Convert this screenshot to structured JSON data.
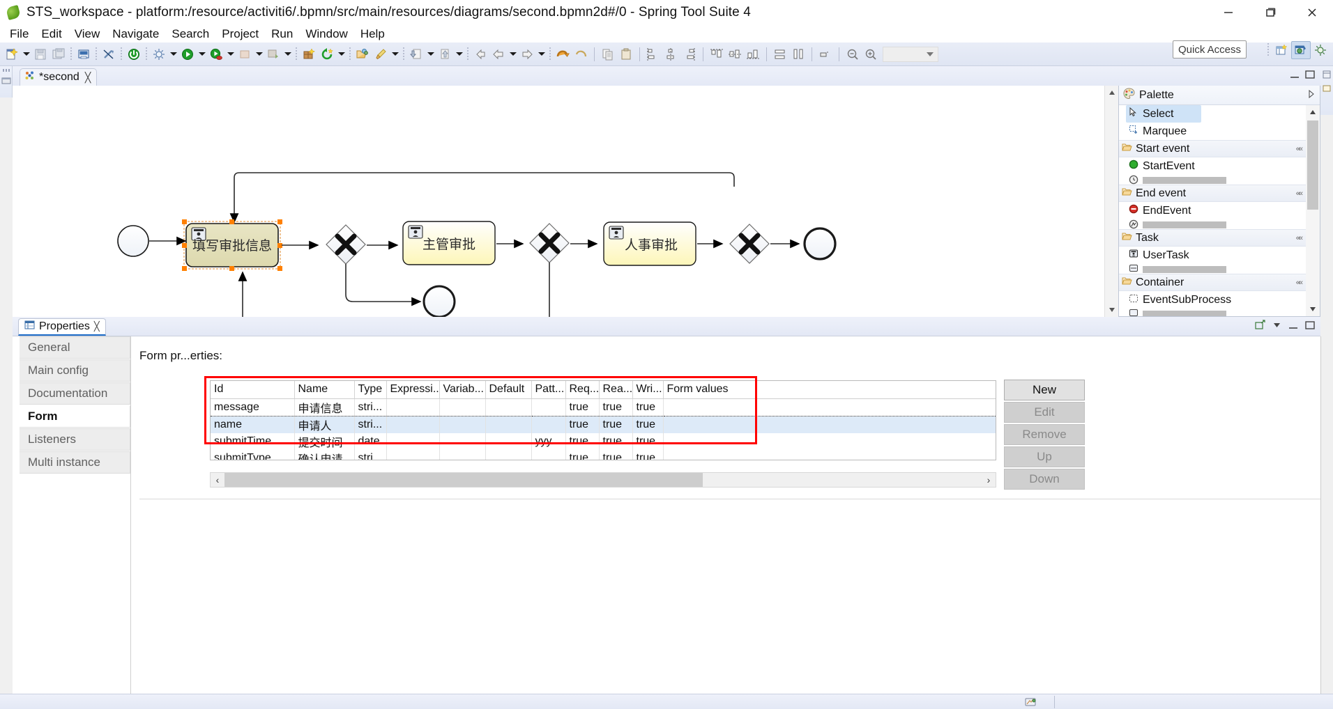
{
  "window": {
    "title": "STS_workspace - platform:/resource/activiti6/.bpmn/src/main/resources/diagrams/second.bpmn2d#/0 - Spring Tool Suite 4",
    "app_icon": "spring-leaf-icon",
    "minimize_label": "Minimize",
    "maximize_label": "Maximize",
    "close_label": "Close"
  },
  "menubar": {
    "items": [
      {
        "label": "File"
      },
      {
        "label": "Edit"
      },
      {
        "label": "View"
      },
      {
        "label": "Navigate"
      },
      {
        "label": "Search"
      },
      {
        "label": "Project"
      },
      {
        "label": "Run"
      },
      {
        "label": "Window"
      },
      {
        "label": "Help"
      }
    ]
  },
  "toolbar": {
    "quick_access_label": "Quick Access",
    "zoom_combo_value": "",
    "items": [
      {
        "name": "new-wizard-icon"
      },
      {
        "name": "save-icon"
      },
      {
        "name": "save-all-icon"
      },
      {
        "name": "print-icon"
      },
      {
        "name": "toggle-breakpoint-icon"
      },
      {
        "name": "terminate-icon"
      },
      {
        "name": "debug-icon"
      },
      {
        "name": "run-icon"
      },
      {
        "name": "run-coverage-icon"
      },
      {
        "name": "boot-dashboard-icon"
      },
      {
        "name": "external-tools-icon"
      },
      {
        "name": "new-package-icon"
      },
      {
        "name": "refresh-icon"
      },
      {
        "name": "open-type-icon"
      },
      {
        "name": "format-brush-icon"
      },
      {
        "name": "import-icon"
      },
      {
        "name": "export-icon"
      },
      {
        "name": "back-icon"
      },
      {
        "name": "forward-icon"
      },
      {
        "name": "undo-icon"
      },
      {
        "name": "redo-icon"
      },
      {
        "name": "copy-icon"
      },
      {
        "name": "paste-icon"
      },
      {
        "name": "align-left-icon"
      },
      {
        "name": "align-center-icon"
      },
      {
        "name": "align-right-icon"
      },
      {
        "name": "align-top-icon"
      },
      {
        "name": "align-middle-icon"
      },
      {
        "name": "align-bottom-icon"
      },
      {
        "name": "match-width-icon"
      },
      {
        "name": "match-height-icon"
      },
      {
        "name": "snap-to-grid-icon"
      },
      {
        "name": "zoom-out-icon"
      },
      {
        "name": "zoom-in-icon"
      }
    ]
  },
  "editor": {
    "tab_label": "*second",
    "tab_icon": "bpmn-diagram-icon",
    "tab_close": "╳",
    "minimize_label": "Minimize",
    "maximize_label": "Maximize"
  },
  "diagram": {
    "nodes": [
      {
        "id": "startEvent",
        "type": "start-event",
        "label": ""
      },
      {
        "id": "task1",
        "type": "user-task",
        "label": "填写审批信息",
        "selected": true
      },
      {
        "id": "gateway1",
        "type": "exclusive-gateway",
        "label": ""
      },
      {
        "id": "task2",
        "type": "user-task",
        "label": "主管审批",
        "selected": false
      },
      {
        "id": "gateway2",
        "type": "exclusive-gateway",
        "label": ""
      },
      {
        "id": "task3",
        "type": "user-task",
        "label": "人事审批",
        "selected": false
      },
      {
        "id": "gateway3",
        "type": "exclusive-gateway",
        "label": ""
      },
      {
        "id": "endEvent",
        "type": "end-event",
        "label": ""
      },
      {
        "id": "endEvent2",
        "type": "end-event",
        "label": ""
      }
    ]
  },
  "palette": {
    "title": "Palette",
    "pin_icon": "pin-icon",
    "tools": [
      {
        "label": "Select",
        "icon": "cursor-icon",
        "selected": true
      },
      {
        "label": "Marquee",
        "icon": "marquee-icon",
        "selected": false
      }
    ],
    "groups": [
      {
        "label": "Start event",
        "icon": "folder-open-icon",
        "items": [
          {
            "label": "StartEvent",
            "icon": "start-event-icon"
          }
        ]
      },
      {
        "label": "End event",
        "icon": "folder-open-icon",
        "items": [
          {
            "label": "EndEvent",
            "icon": "end-event-icon"
          }
        ]
      },
      {
        "label": "Task",
        "icon": "folder-open-icon",
        "items": [
          {
            "label": "UserTask",
            "icon": "user-task-icon"
          }
        ]
      },
      {
        "label": "Container",
        "icon": "folder-open-icon",
        "items": [
          {
            "label": "EventSubProcess",
            "icon": "event-subprocess-icon"
          }
        ]
      }
    ]
  },
  "properties": {
    "view_title": "Properties",
    "view_icon": "properties-icon",
    "view_close": "╳",
    "tabs": [
      {
        "label": "General",
        "active": false
      },
      {
        "label": "Main config",
        "active": false
      },
      {
        "label": "Documentation",
        "active": false
      },
      {
        "label": "Form",
        "active": true
      },
      {
        "label": "Listeners",
        "active": false
      },
      {
        "label": "Multi instance",
        "active": false
      }
    ],
    "section_label": "Form pr...erties:",
    "table": {
      "columns": [
        "Id",
        "Name",
        "Type",
        "Expressi...",
        "Variab...",
        "Default",
        "Patt...",
        "Req...",
        "Rea...",
        "Wri...",
        "Form values"
      ],
      "rows": [
        {
          "focused": true,
          "selected": false,
          "cells": [
            "message",
            "申请信息",
            "stri...",
            "",
            "",
            "",
            "",
            "true",
            "true",
            "true",
            ""
          ]
        },
        {
          "focused": false,
          "selected": true,
          "cells": [
            "name",
            "申请人",
            "stri...",
            "",
            "",
            "",
            "",
            "true",
            "true",
            "true",
            ""
          ]
        },
        {
          "focused": false,
          "selected": false,
          "cells": [
            "submitTime",
            "提交时间",
            "date",
            "",
            "",
            "",
            "yyy...",
            "true",
            "true",
            "true",
            ""
          ]
        },
        {
          "focused": false,
          "selected": false,
          "cells": [
            "submitType",
            "确认申请",
            "stri...",
            "",
            "",
            "",
            "",
            "true",
            "true",
            "true",
            ""
          ]
        }
      ]
    },
    "buttons": [
      {
        "label": "New",
        "enabled": true
      },
      {
        "label": "Edit",
        "enabled": false
      },
      {
        "label": "Remove",
        "enabled": false
      },
      {
        "label": "Up",
        "enabled": false
      },
      {
        "label": "Down",
        "enabled": false
      }
    ],
    "hscroll": {
      "left_arrow": "‹",
      "right_arrow": "›"
    }
  },
  "statusbar": {
    "icon": "writable-icon",
    "text": ""
  },
  "colors": {
    "accent": "#1b6ac6",
    "highlight_box": "#ff0000",
    "task_fill_selected": "#e3e0bd",
    "task_fill": "#fffde3",
    "selection_handle": "#ff8000",
    "palette_selected": "#cfe3f7",
    "row_selected": "#ddeaf8"
  }
}
